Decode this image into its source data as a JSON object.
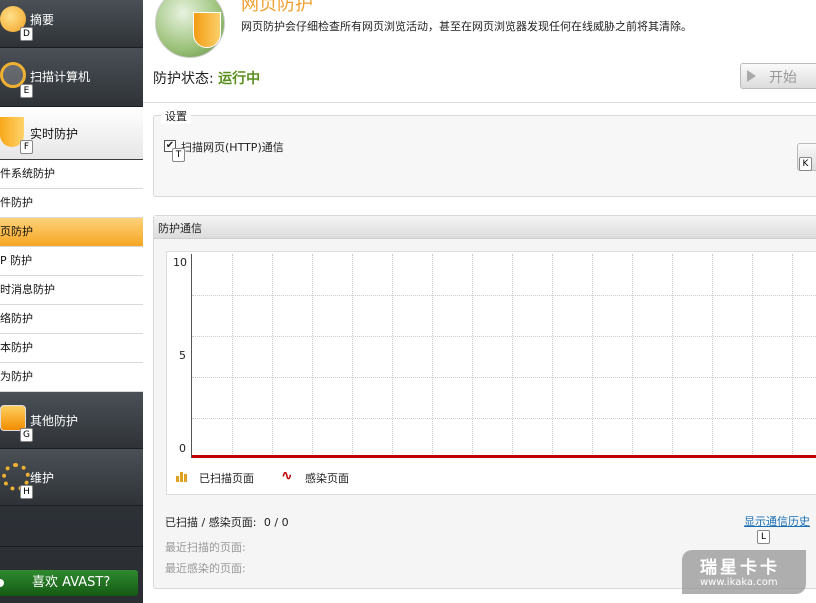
{
  "sidebar": {
    "summary": {
      "label": "摘要",
      "key": "D"
    },
    "scan": {
      "label": "扫描计算机",
      "key": "E"
    },
    "realtime": {
      "label": "实时防护",
      "key": "F"
    },
    "shields": [
      {
        "label": "件系统防护"
      },
      {
        "label": "件防护"
      },
      {
        "label": "页防护"
      },
      {
        "label": "P 防护"
      },
      {
        "label": "时消息防护"
      },
      {
        "label": "络防护"
      },
      {
        "label": "本防护"
      },
      {
        "label": "为防护"
      }
    ],
    "other": {
      "label": "其他防护",
      "key": "G"
    },
    "maintenance": {
      "label": "维护",
      "key": "H"
    },
    "like": {
      "label": "喜欢 AVAST?"
    }
  },
  "header": {
    "title": "网页防护",
    "description": "网页防护会仔细检查所有网页浏览活动，甚至在网页浏览器发现任何在线威胁之前将其清除。"
  },
  "status": {
    "label": "防护状态:",
    "value": "运行中"
  },
  "start_button": {
    "label": "开始"
  },
  "settings": {
    "title": "设置",
    "checkbox_label": "扫描网页(HTTP)通信",
    "checkbox_key": "T",
    "button_key": "K"
  },
  "traffic": {
    "title": "防护通信",
    "legend_scanned": "已扫描页面",
    "legend_infected": "感染页面",
    "scanned_infected_label": "已扫描 / 感染页面:",
    "scanned_infected_value": "0 / 0",
    "history_link": "显示通信历史",
    "history_key": "L",
    "last_scanned_label": "最近扫描的页面:",
    "last_infected_label": "最近感染的页面:"
  },
  "chart_data": {
    "type": "line",
    "y_ticks": [
      "10",
      "5",
      "0"
    ],
    "ylim": [
      0,
      10
    ],
    "grid": true,
    "series": [
      {
        "name": "已扫描页面",
        "values": [
          0
        ],
        "color": "#e0a020"
      },
      {
        "name": "感染页面",
        "values": [
          0
        ],
        "color": "#c00000"
      }
    ]
  },
  "watermark": {
    "line1": "瑞星卡卡",
    "line2": "www.ikaka.com"
  }
}
